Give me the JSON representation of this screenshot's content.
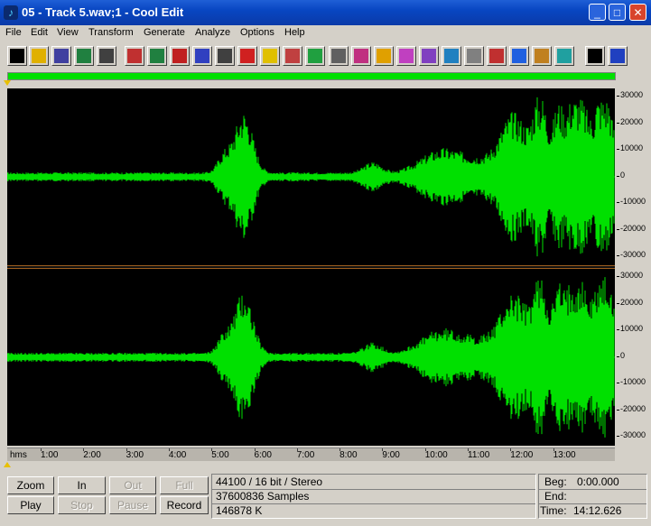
{
  "window": {
    "title": "05 - Track  5.wav;1 - Cool Edit",
    "controls": {
      "minimize": "_",
      "maximize": "□",
      "close": "✕"
    }
  },
  "menu": [
    "File",
    "Edit",
    "View",
    "Transform",
    "Generate",
    "Analyze",
    "Options",
    "Help"
  ],
  "toolbar": [
    {
      "name": "waveform-edit-icon",
      "color": "#000000"
    },
    {
      "name": "open-file-icon",
      "color": "#e0b000"
    },
    {
      "name": "save-icon",
      "color": "#4040a0"
    },
    {
      "name": "grid-icon",
      "color": "#208040"
    },
    {
      "name": "headphones-icon",
      "color": "#404040"
    },
    {
      "name": "rewind-marks-icon",
      "color": "#c03030"
    },
    {
      "name": "stereo-icon",
      "color": "#208040"
    },
    {
      "name": "loop-icon",
      "color": "#c02020"
    },
    {
      "name": "music-note-icon",
      "color": "#3040c0"
    },
    {
      "name": "diamond-icon",
      "color": "#404040"
    },
    {
      "name": "arrow-down-icon",
      "color": "#d02020"
    },
    {
      "name": "triangle-icon",
      "color": "#e0c000"
    },
    {
      "name": "lines-icon",
      "color": "#c04040"
    },
    {
      "name": "grid-green-icon",
      "color": "#20a040"
    },
    {
      "name": "clock-icon",
      "color": "#606060"
    },
    {
      "name": "radio-wave-icon",
      "color": "#c03080"
    },
    {
      "name": "tape-icon",
      "color": "#e0a000"
    },
    {
      "name": "spectrum-icon",
      "color": "#c040c0"
    },
    {
      "name": "matrix-icon",
      "color": "#8040c0"
    },
    {
      "name": "wave-lines-icon",
      "color": "#2080c0"
    },
    {
      "name": "noise-icon",
      "color": "#808080"
    },
    {
      "name": "filter-icon",
      "color": "#c03030"
    },
    {
      "name": "wave-curve-icon",
      "color": "#2060e0"
    },
    {
      "name": "gradient-icon",
      "color": "#c08020"
    },
    {
      "name": "hourglass-icon",
      "color": "#20a0a0"
    },
    {
      "name": "multitrack-icon",
      "color": "#000000"
    },
    {
      "name": "multitrack-color-icon",
      "color": "#2040c0"
    }
  ],
  "waveform": {
    "color": "#00e000",
    "background": "#000000"
  },
  "amplitude_scale": [
    "30000",
    "20000",
    "10000",
    "0",
    "-10000",
    "-20000",
    "-30000"
  ],
  "time_ruler": {
    "unit": "hms",
    "labels": [
      "1:00",
      "2:00",
      "3:00",
      "4:00",
      "5:00",
      "6:00",
      "7:00",
      "8:00",
      "9:00",
      "10:00",
      "11:00",
      "12:00",
      "13:00"
    ]
  },
  "transport": {
    "zoom": "Zoom",
    "in": "In",
    "out": "Out",
    "full": "Full",
    "play": "Play",
    "stop": "Stop",
    "pause": "Pause",
    "record": "Record"
  },
  "file_info": {
    "format": "44100 / 16 bit / Stereo",
    "samples": "37600836 Samples",
    "size": "146878 K"
  },
  "selection": {
    "beg_label": "Beg:",
    "beg_value": "0:00.000",
    "end_label": "End:",
    "end_value": "",
    "time_label": "Time:",
    "time_value": "14:12.626"
  }
}
